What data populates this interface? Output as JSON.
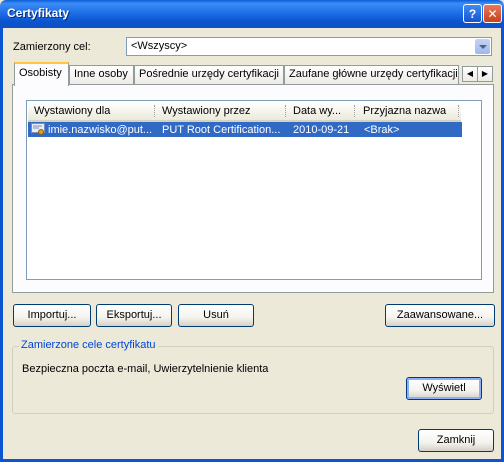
{
  "window": {
    "title": "Certyfikaty",
    "help_glyph": "?",
    "close_glyph": "✕"
  },
  "purpose": {
    "label": "Zamierzony cel:",
    "value": "<Wszyscy>"
  },
  "tabs": [
    {
      "label": "Osobisty",
      "active": true
    },
    {
      "label": "Inne osoby"
    },
    {
      "label": "Pośrednie urzędy certyfikacji"
    },
    {
      "label": "Zaufane główne urzędy certyfikacji"
    }
  ],
  "tab_scroll": {
    "left": "◀",
    "right": "▶"
  },
  "list": {
    "columns": [
      "Wystawiony dla",
      "Wystawiony przez",
      "Data wy...",
      "Przyjazna nazwa"
    ],
    "rows": [
      {
        "issued_to": "imie.nazwisko@put...",
        "issued_by": "PUT Root Certification...",
        "date": "2010-09-21",
        "friendly": "<Brak>",
        "selected": true,
        "icon": "certificate-icon"
      }
    ]
  },
  "buttons": {
    "import": "Importuj...",
    "export": "Eksportuj...",
    "remove": "Usuń",
    "advanced": "Zaawansowane...",
    "view": "Wyświetl",
    "close": "Zamknij"
  },
  "purposes_group": {
    "title": "Zamierzone cele certyfikatu",
    "text": "Bezpieczna poczta e-mail, Uwierzytelnienie klienta"
  },
  "colors": {
    "title_bar": "#0B55D0",
    "selection": "#316AC5",
    "group_title": "#0046D5",
    "dialog_bg": "#ECE9D8"
  }
}
